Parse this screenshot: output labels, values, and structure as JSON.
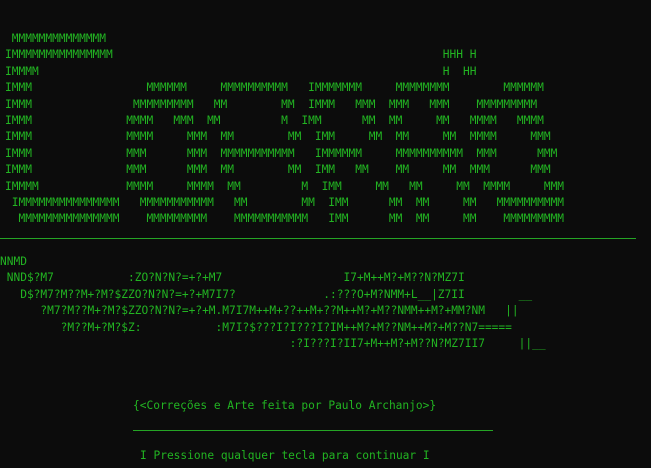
{
  "ascii_title": [
    " MMMMMMMMMMMMMM",
    "IMMMMMMMMMMMMMMM                                                 HHH H",
    "IMMMM                                                            H  HH",
    "IMMM                 MMMMMM     MMMMMMMMMM   IMMMMMMM     MMMMMMMM        MMMMMM",
    "IMMM               MMMMMMMMM   MM        MM  IMMM   MMM  MMM   MMM    MMMMMMMMM",
    "IMMM              MMMM   MMM  MM         M  IMM      MM  MM     MM   MMMM   MMMM",
    "IMMM              MMMM     MMM  MM        MM  IMM     MM  MM     MM  MMMM     MMM",
    "IMMM              MMM      MMM  MMMMMMMMMMM   IMMMMMM     MMMMMMMMMM  MMM      MMM",
    "IMMM              MMM      MMM  MM        MM  IMM   MM    MM     MM  MMM      MMM",
    "IMMMM             MMMM     MMMM  MM         M  IMM     MM   MM     MM  MMMM     MMM",
    " IMMMMMMMMMMMMMMM   MMMMMMMMMMM   MM        MM  IMM      MM  MM     MM   MMMMMMMMMM",
    "  MMMMMMMMMMMMMMM    MMMMMMMMM    MMMMMMMMMMM   IMM      MM  MM     MM    MMMMMMMMM"
  ],
  "ascii_sub": [
    "NNMD",
    " NND$?M7           :ZO?N?N?=+?+M7                  I7+M++M?+M??N?MZ7I",
    "   D$?M7?M??M+?M?$ZZO?N?N?=+?+M7I7?             .:???O+M?NMM+L__|Z7II        __",
    "      ?M7?M??M+?M?$ZZO?N?N?=+?+M.M7I7M++M+??++M+??M++M?+M??NMM++M?+MM?NM   ||",
    "         ?M??M+?M?$Z:           :M7I?$???I?I???I?IM++M?+M??NM++M?+M??N7=====",
    "                                           :?I???I?II7+M++M?+M??N?MZ7II7     ||__"
  ],
  "credit_text": "{<Correções e Arte feita por Paulo Archanjo>}",
  "prompt_text": "I Pressione qualquer tecla para continuar I"
}
